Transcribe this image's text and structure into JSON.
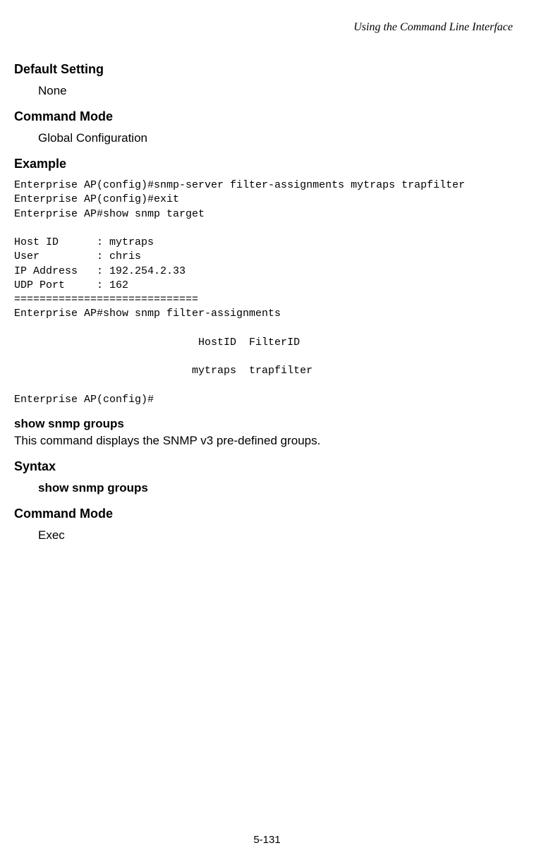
{
  "header": {
    "title": "Using the Command Line Interface"
  },
  "sections": {
    "default_setting": {
      "heading": "Default Setting",
      "value": "None"
    },
    "command_mode_1": {
      "heading": "Command Mode",
      "value": "Global Configuration"
    },
    "example": {
      "heading": "Example",
      "code": "Enterprise AP(config)#snmp-server filter-assignments mytraps trapfilter\nEnterprise AP(config)#exit\nEnterprise AP#show snmp target\n\nHost ID      : mytraps\nUser         : chris\nIP Address   : 192.254.2.33\nUDP Port     : 162\n=============================\nEnterprise AP#show snmp filter-assignments\n\n                             HostID  FilterID\n\n                            mytraps  trapfilter\n\nEnterprise AP(config)#"
    },
    "show_snmp_groups": {
      "heading": "show snmp groups",
      "description": "This command displays the SNMP v3 pre-defined groups."
    },
    "syntax": {
      "heading": "Syntax",
      "value": "show snmp groups"
    },
    "command_mode_2": {
      "heading": "Command Mode",
      "value": "Exec"
    }
  },
  "footer": {
    "page_number": "5-131"
  }
}
